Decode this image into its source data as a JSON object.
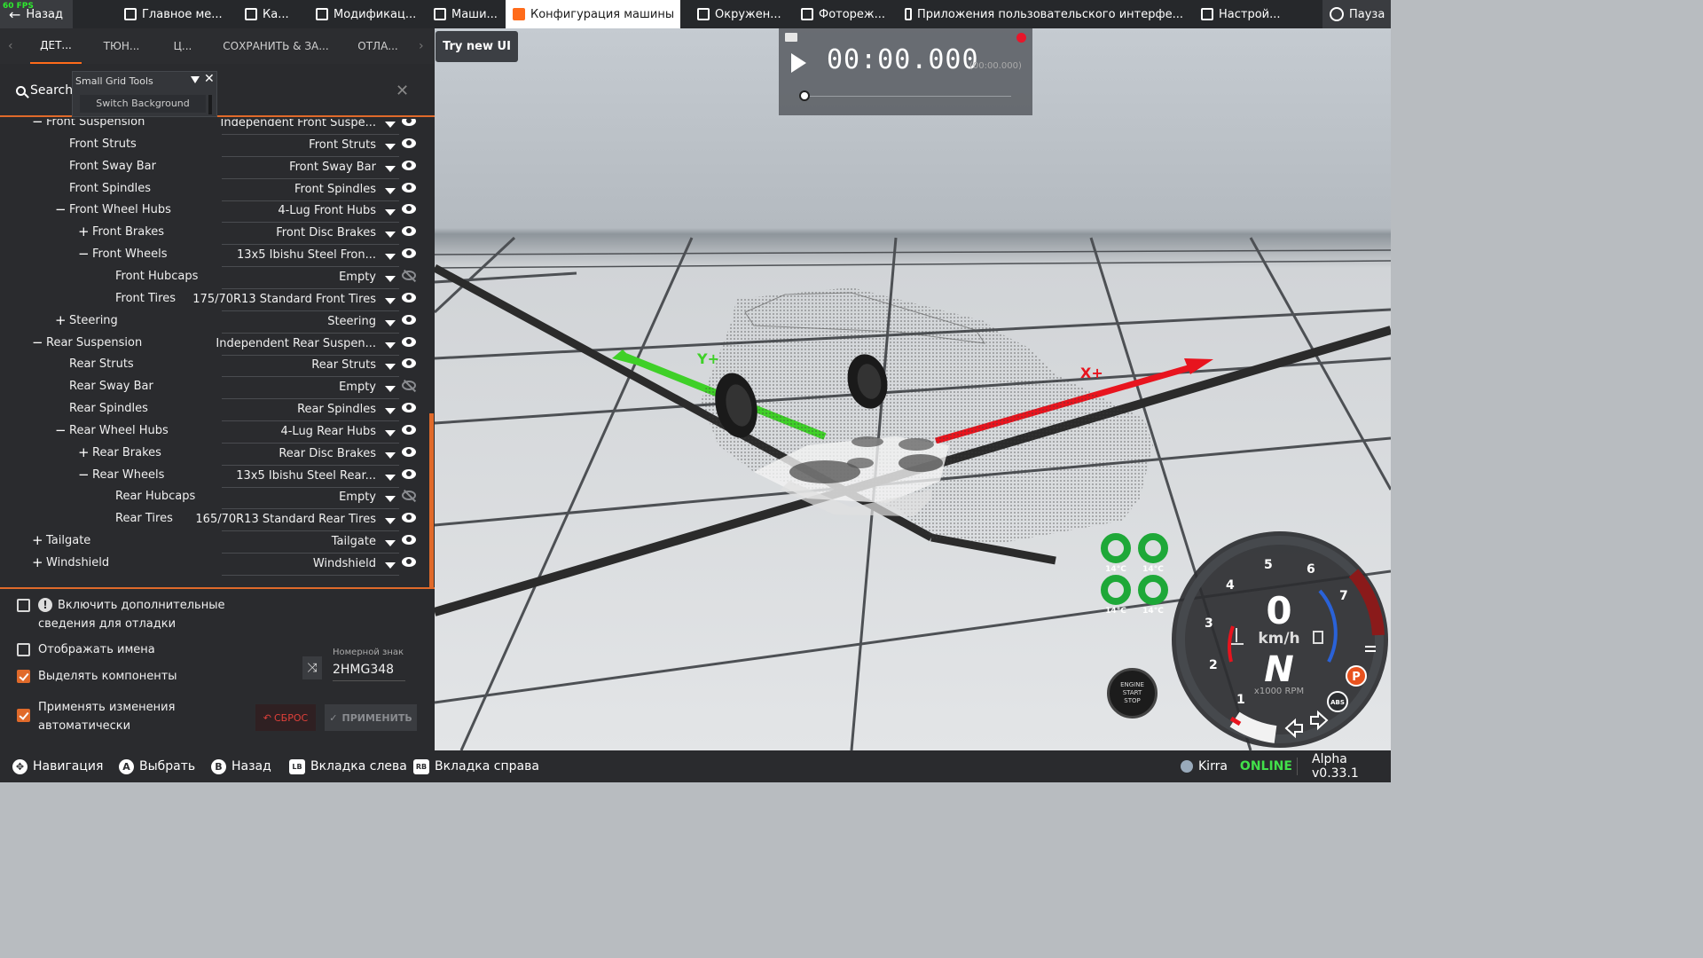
{
  "fps": "60 FPS",
  "topnav": {
    "back": "Назад",
    "items": [
      {
        "label": "Главное ме...",
        "icon": "grid-icon"
      },
      {
        "label": "Ка...",
        "icon": "map-icon"
      },
      {
        "label": "Модификац...",
        "icon": "puzzle-icon"
      },
      {
        "label": "Маши...",
        "icon": "car-icon"
      },
      {
        "label": "Конфигурация машины",
        "icon": "engine-icon"
      },
      {
        "label": "Окружен...",
        "icon": "weather-icon"
      },
      {
        "label": "Фотореж...",
        "icon": "camera-icon"
      },
      {
        "label": "Приложения пользовательского интерфе...",
        "icon": "apps-icon"
      },
      {
        "label": "Настрой...",
        "icon": "sliders-icon"
      }
    ],
    "pause": "Пауза"
  },
  "tabs": [
    "ДЕТ...",
    "ТЮН...",
    "Ц...",
    "СОХРАНИТЬ & ЗА...",
    "ОТЛА..."
  ],
  "search": {
    "label": "Search"
  },
  "grid_tools": {
    "title": "Small Grid Tools",
    "button": "Switch Background"
  },
  "parts": [
    {
      "name": "Front Suspension",
      "value": "Independent Front Suspe...",
      "sign": "−",
      "visible": true
    },
    {
      "name": "Front Struts",
      "value": "Front Struts",
      "sign": "",
      "visible": true
    },
    {
      "name": "Front Sway Bar",
      "value": "Front Sway Bar",
      "sign": "",
      "visible": true
    },
    {
      "name": "Front Spindles",
      "value": "Front Spindles",
      "sign": "",
      "visible": true
    },
    {
      "name": "Front Wheel Hubs",
      "value": "4-Lug Front Hubs",
      "sign": "−",
      "visible": true
    },
    {
      "name": "Front Brakes",
      "value": "Front Disc Brakes",
      "sign": "+",
      "visible": true
    },
    {
      "name": "Front Wheels",
      "value": "13x5 Ibishu Steel Fron...",
      "sign": "−",
      "visible": true
    },
    {
      "name": "Front Hubcaps",
      "value": "Empty",
      "sign": "",
      "visible": false
    },
    {
      "name": "Front Tires",
      "value": "175/70R13 Standard Front Tires",
      "sign": "",
      "visible": true
    },
    {
      "name": "Steering",
      "value": "Steering",
      "sign": "+",
      "visible": true
    },
    {
      "name": "Rear Suspension",
      "value": "Independent Rear Suspen...",
      "sign": "−",
      "visible": true
    },
    {
      "name": "Rear Struts",
      "value": "Rear Struts",
      "sign": "",
      "visible": true
    },
    {
      "name": "Rear Sway Bar",
      "value": "Empty",
      "sign": "",
      "visible": false
    },
    {
      "name": "Rear Spindles",
      "value": "Rear Spindles",
      "sign": "",
      "visible": true
    },
    {
      "name": "Rear Wheel Hubs",
      "value": "4-Lug Rear Hubs",
      "sign": "−",
      "visible": true
    },
    {
      "name": "Rear Brakes",
      "value": "Rear Disc Brakes",
      "sign": "+",
      "visible": true
    },
    {
      "name": "Rear Wheels",
      "value": "13x5 Ibishu Steel Rear...",
      "sign": "−",
      "visible": true
    },
    {
      "name": "Rear Hubcaps",
      "value": "Empty",
      "sign": "",
      "visible": false
    },
    {
      "name": "Rear Tires",
      "value": "165/70R13 Standard Rear Tires",
      "sign": "",
      "visible": true
    },
    {
      "name": "Tailgate",
      "value": "Tailgate",
      "sign": "+",
      "visible": true
    },
    {
      "name": "Windshield",
      "value": "Windshield",
      "sign": "+",
      "visible": true
    }
  ],
  "options": {
    "debug_info": "Включить дополнительные сведения для отладки",
    "show_names": "Отображать имена",
    "highlight": "Выделять компоненты",
    "auto_apply": "Применять изменения автоматически",
    "plate_label": "Номерной знак",
    "plate_value": "2HMG348",
    "reset": "СБРОС",
    "apply": "ПРИМЕНИТЬ",
    "checked": {
      "debug_info": false,
      "show_names": false,
      "highlight": true,
      "auto_apply": true
    }
  },
  "try_new_ui": "Try new UI",
  "replay": {
    "time": "00:00.000",
    "time_small": "(00:00.000)"
  },
  "hud": {
    "speed": "0",
    "speed_unit": "km/h",
    "gear": "N",
    "rpm_unit": "x1000 RPM",
    "rpm_ticks": [
      "1",
      "2",
      "3",
      "4",
      "5",
      "6",
      "7"
    ],
    "tire_temps": [
      "14°C",
      "14°C",
      "14°C",
      "14°C"
    ],
    "engine_btn": [
      "ENGINE",
      "START",
      "STOP"
    ],
    "parking": "P",
    "abs": "ABS",
    "axis_x": "X+",
    "axis_y": "Y+"
  },
  "bottombar": {
    "hints": [
      {
        "glyph": "✥",
        "label": "Навигация"
      },
      {
        "glyph": "A",
        "label": "Выбрать"
      },
      {
        "glyph": "B",
        "label": "Назад"
      },
      {
        "glyph": "LB",
        "label": "Вкладка слева"
      },
      {
        "glyph": "RB",
        "label": "Вкладка справа"
      }
    ],
    "user": "Kirra",
    "status": "ONLINE",
    "version": "Alpha v0.33.1"
  },
  "colors": {
    "accent": "#e06a2a",
    "online": "#42e04a",
    "axis_x": "#e8141e",
    "axis_y": "#3fd028"
  }
}
